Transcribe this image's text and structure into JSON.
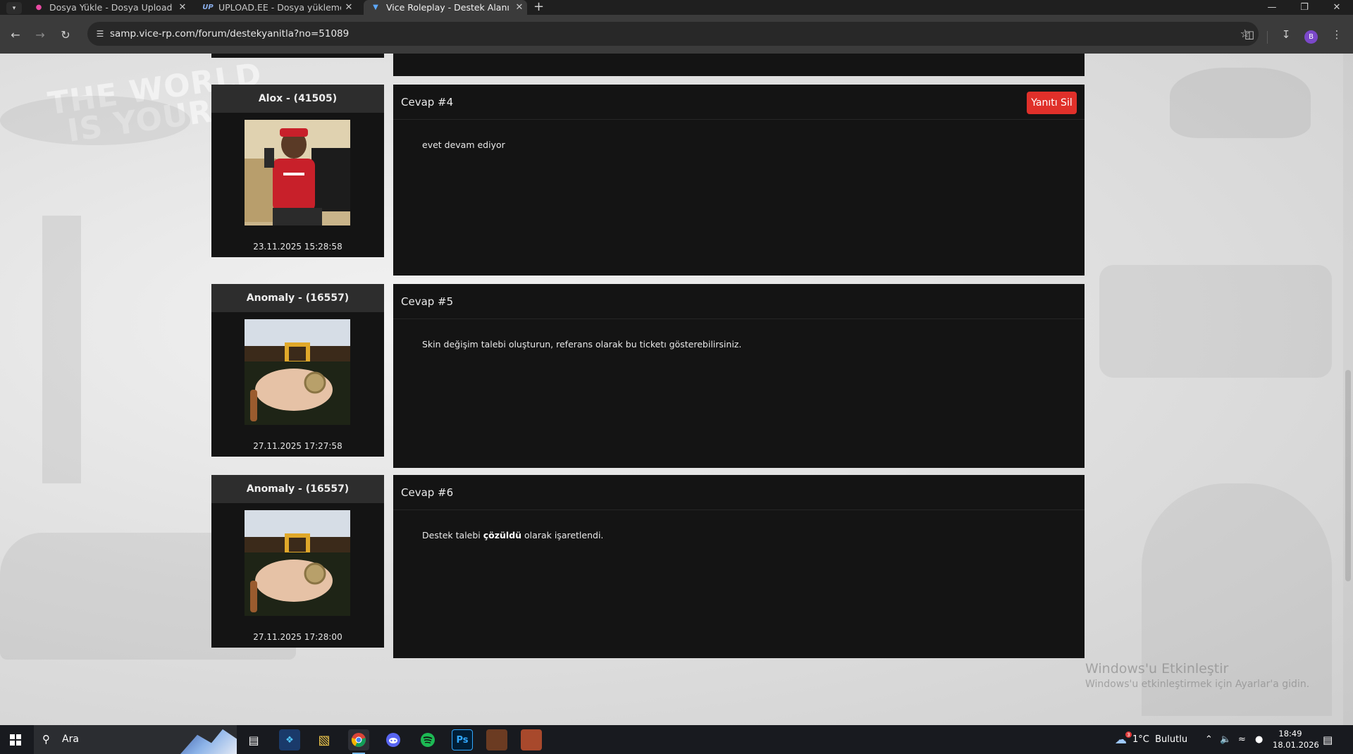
{
  "browser": {
    "tabs": [
      {
        "title": "Dosya Yükle - Dosya Upload",
        "favicon": "pink-drop-icon",
        "active": false
      },
      {
        "title": "UPLOAD.EE - Dosya yükleme ta",
        "favicon": "up-logo-icon",
        "active": false
      },
      {
        "title": "Vice Roleplay - Destek Alanı",
        "favicon": "vice-logo-icon",
        "active": true
      }
    ],
    "url": "samp.vice-rp.com/forum/destekyanitla?no=51089",
    "profile_initial": "B"
  },
  "posts": [
    {
      "user": "Alox - (41505)",
      "date": "23.11.2025 15:28:58",
      "title": "Cevap #4",
      "body": "evet devam ediyor",
      "action_label": "Yanıtı Sil",
      "avatar": "person-red-shirt-avatar"
    },
    {
      "user": "Anomaly - (16557)",
      "date": "27.11.2025 17:27:58",
      "title": "Cevap #5",
      "body": "Skin değişim talebi oluşturun, referans olarak bu ticketı gösterebilirsiniz.",
      "avatar": "hand-cigar-watch-avatar"
    },
    {
      "user": "Anomaly - (16557)",
      "date": "27.11.2025 17:28:00",
      "title": "Cevap #6",
      "body_prefix": "Destek talebi ",
      "body_bold": "çözüldü",
      "body_suffix": " olarak işaretlendi.",
      "avatar": "hand-cigar-watch-avatar"
    }
  ],
  "background": {
    "slogan_line1": "THE WORLD",
    "slogan_line2": "IS YOURS"
  },
  "watermark": {
    "line1": "Windows'u Etkinleştir",
    "line2": "Windows'u etkinleştirmek için Ayarlar'a gidin."
  },
  "taskbar": {
    "search_placeholder": "Ara",
    "weather": "1°C  Bulutlu",
    "weather_badge": "3",
    "time": "18:49",
    "date": "18.01.2026"
  },
  "colors": {
    "panel_bg": "#141414",
    "name_bar_bg": "#2d2d2d",
    "delete_button": "#e0302a",
    "accent_chrome": "#7b48c9"
  }
}
